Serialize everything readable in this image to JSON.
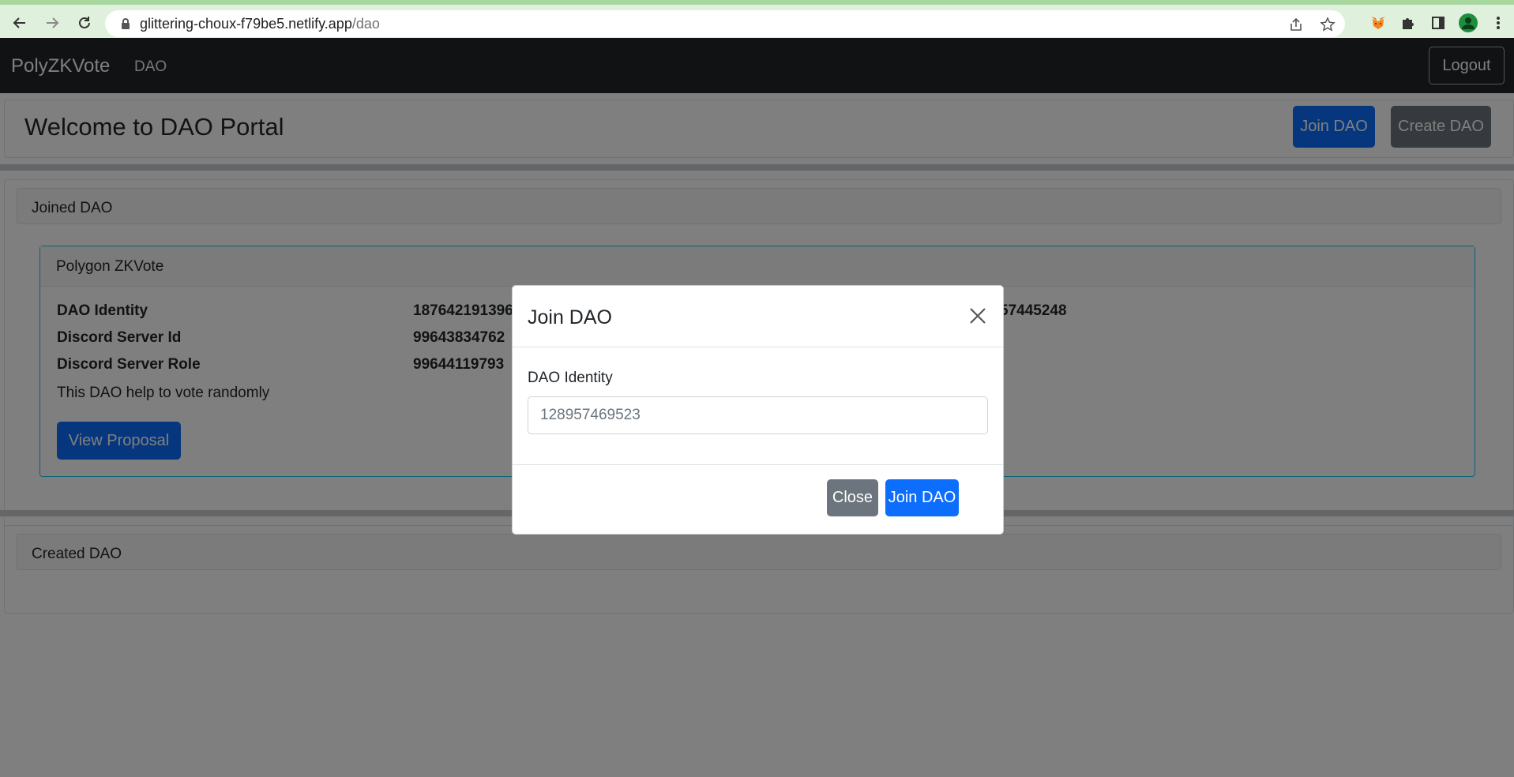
{
  "browser": {
    "url_host": "glittering-choux-f79be5.netlify.app",
    "url_path": "/dao"
  },
  "navbar": {
    "brand": "PolyZKVote",
    "nav_link": "DAO",
    "logout_label": "Logout"
  },
  "page": {
    "title": "Welcome to DAO Portal",
    "join_dao_label": "Join DAO",
    "create_dao_label": "Create DAO"
  },
  "joined_section": {
    "header": "Joined DAO",
    "card": {
      "name": "Polygon ZKVote",
      "rows": [
        {
          "label": "DAO Identity",
          "value": "187642191396",
          "value_tail": "57445248"
        },
        {
          "label": "Discord Server Id",
          "value": "99643834762"
        },
        {
          "label": "Discord Server Role",
          "value": "99644119793"
        }
      ],
      "description": "This DAO help to vote randomly",
      "view_proposal_label": "View Proposal"
    }
  },
  "created_section": {
    "header": "Created DAO"
  },
  "modal": {
    "title": "Join DAO",
    "field_label": "DAO Identity",
    "field_placeholder": "128957469523",
    "close_label": "Close",
    "join_label": "Join DAO"
  },
  "colors": {
    "primary": "#0d6efd",
    "secondary": "#6c757d",
    "navbar": "#212529",
    "card_border": "#0dcaf0"
  }
}
